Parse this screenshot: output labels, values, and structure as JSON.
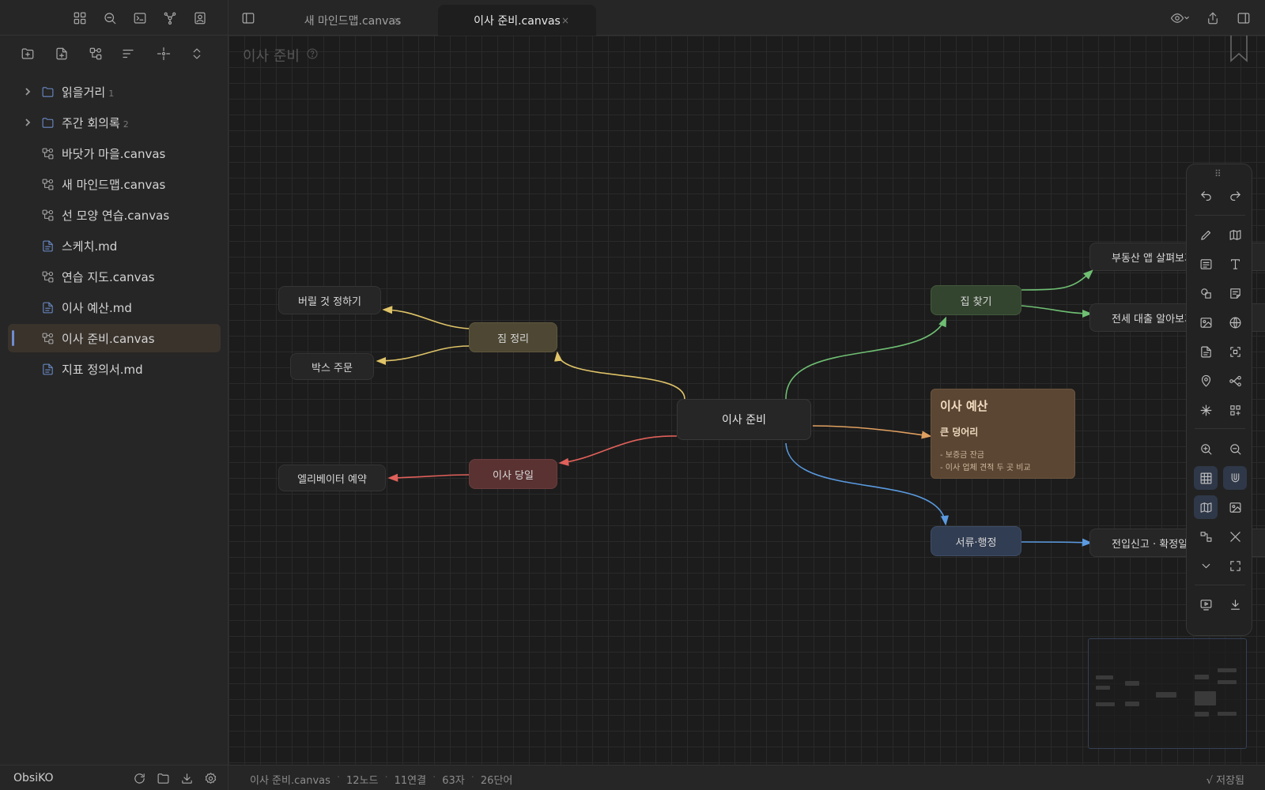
{
  "sidebar": {
    "ribbon_icons": [
      "layout-grid-icon",
      "search-icon",
      "terminal-icon",
      "graph-icon",
      "contacts-icon"
    ],
    "nav_actions": [
      "new-folder-icon",
      "new-note-icon",
      "new-canvas-icon",
      "sort-icon",
      "locate-icon",
      "collapse-icon"
    ],
    "tree": [
      {
        "label": "읽을거리",
        "count": "1",
        "kind": "folder"
      },
      {
        "label": "주간 회의록",
        "count": "2",
        "kind": "folder"
      },
      {
        "label": "바닷가 마을.canvas",
        "kind": "canvas"
      },
      {
        "label": "새 마인드맵.canvas",
        "kind": "canvas"
      },
      {
        "label": "선 모양 연습.canvas",
        "kind": "canvas"
      },
      {
        "label": "스케치.md",
        "kind": "md"
      },
      {
        "label": "연습 지도.canvas",
        "kind": "canvas"
      },
      {
        "label": "이사 예산.md",
        "kind": "md"
      },
      {
        "label": "이사 준비.canvas",
        "kind": "canvas",
        "active": true
      },
      {
        "label": "지표 정의서.md",
        "kind": "md"
      }
    ],
    "vault_name": "ObsiKO"
  },
  "tabs": [
    {
      "title": "새 마인드맵.canvas",
      "close": "×"
    },
    {
      "title": "이사 준비.canvas",
      "close": "×",
      "active": true
    }
  ],
  "canvas": {
    "title": "이사 준비",
    "center_node": "이사 준비",
    "nodes": {
      "throw_away": "버릴 것 정하기",
      "tidy": "짐 정리",
      "box_order": "박스 주문",
      "elevator": "엘리베이터 예약",
      "moving_day": "이사 당일",
      "find_house": "집 찾기",
      "realestate_app": "부동산 앱 살펴보기",
      "jeonse_loan": "전세 대출 알아보기",
      "paperwork": "서류·행정",
      "move_in_report": "전입신고 · 확정일자"
    },
    "budget_card": {
      "title": "이사 예산",
      "subtitle": "큰 덩어리",
      "lines": [
        "- 보증금 잔금",
        "- 이사 업체 견적 두 곳 비교"
      ]
    },
    "edge_colors": {
      "yellow": "#e0c468",
      "green": "#6fbf73",
      "red": "#e0605a",
      "blue": "#5a9ae0",
      "orange": "#e0a060"
    }
  },
  "status": {
    "file": "이사 준비.canvas",
    "nodes": "12노드",
    "edges": "11연결",
    "chars": "63자",
    "words": "26단어",
    "saved": "√ 저장됨"
  }
}
